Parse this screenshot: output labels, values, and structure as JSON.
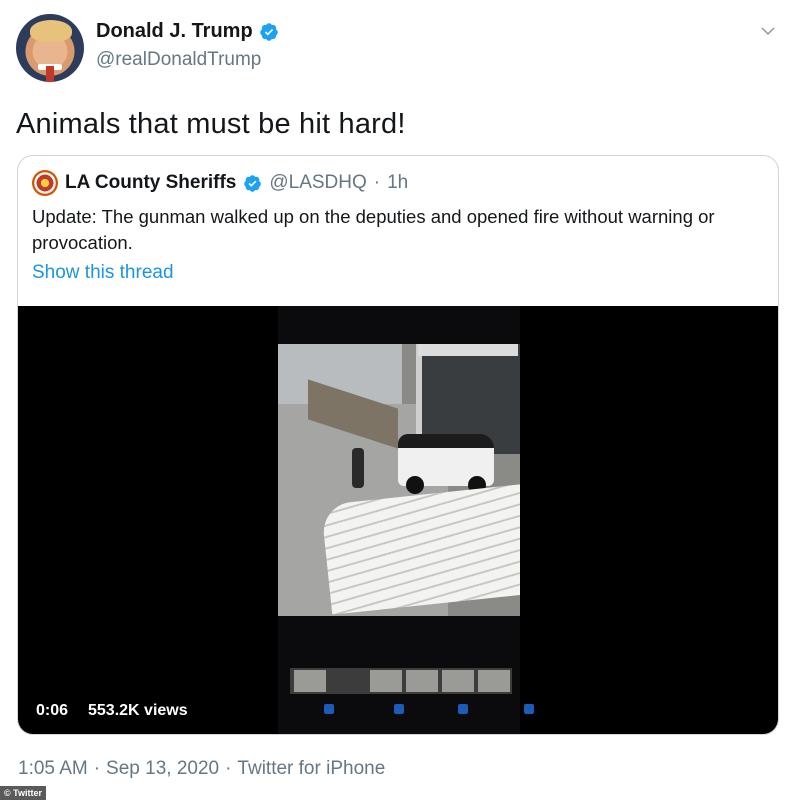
{
  "author": {
    "display_name": "Donald J. Trump",
    "handle": "@realDonaldTrump",
    "verified_icon": "verified-badge-icon"
  },
  "tweet": {
    "text": "Animals that must be hit hard!"
  },
  "quoted_tweet": {
    "display_name": "LA County Sheriffs",
    "handle": "@LASDHQ",
    "separator": "·",
    "time": "1h",
    "text": "Update: The gunman walked up on the deputies and opened fire without warning or provocation.",
    "show_thread": "Show this thread",
    "video": {
      "elapsed": "0:06",
      "views": "553.2K views"
    }
  },
  "meta": {
    "time": "1:05 AM",
    "sep1": "·",
    "date": "Sep 13, 2020",
    "sep2": "·",
    "source": "Twitter for iPhone"
  },
  "watermark": "© Twitter",
  "colors": {
    "link_blue": "#1b95e0",
    "verified_blue": "#1da1f2",
    "secondary_text": "#657786"
  }
}
